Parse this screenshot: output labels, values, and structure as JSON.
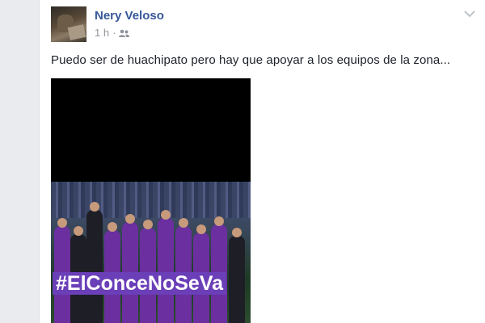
{
  "post": {
    "author": "Nery Veloso",
    "time": "1 h",
    "separator": "·",
    "audience_icon": "friends-icon",
    "options_icon": "chevron-down-icon",
    "text": "Puedo ser de huachipato pero hay que apoyar a los equipos de la zona...",
    "photo": {
      "hashtag": "#ElConceNoSeVa",
      "jersey_color": "#6b2fa0"
    }
  },
  "colors": {
    "author_link": "#365899",
    "meta_text": "#90949c",
    "body_text": "#1d2129",
    "background": "#e9ebee"
  }
}
